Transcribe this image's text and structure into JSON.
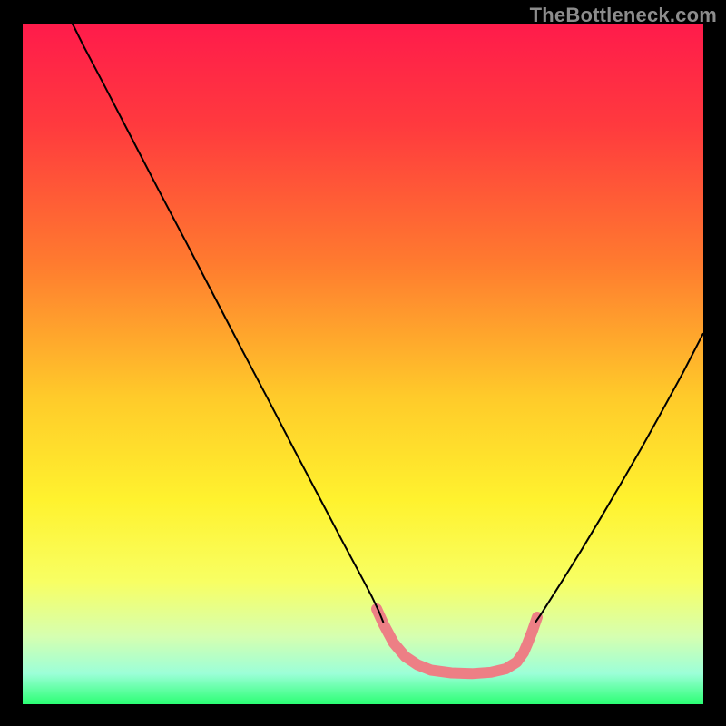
{
  "attribution": "TheBottleneck.com",
  "chart_data": {
    "type": "line",
    "title": "",
    "xlabel": "",
    "ylabel": "",
    "xlim": [
      0,
      1
    ],
    "ylim": [
      0,
      1
    ],
    "gradient_stops": [
      {
        "offset": 0.0,
        "color": "#ff1b4b"
      },
      {
        "offset": 0.15,
        "color": "#ff3a3e"
      },
      {
        "offset": 0.35,
        "color": "#ff7a2f"
      },
      {
        "offset": 0.55,
        "color": "#ffcb2a"
      },
      {
        "offset": 0.7,
        "color": "#fff22e"
      },
      {
        "offset": 0.82,
        "color": "#f8ff63"
      },
      {
        "offset": 0.9,
        "color": "#d6ffb0"
      },
      {
        "offset": 0.955,
        "color": "#9cffd8"
      },
      {
        "offset": 1.0,
        "color": "#2bff74"
      }
    ],
    "series": [
      {
        "name": "left-curve",
        "stroke": "#000000",
        "stroke_width": 2,
        "points": [
          [
            0.073,
            1.0
          ],
          [
            0.09,
            0.966
          ],
          [
            0.12,
            0.909
          ],
          [
            0.16,
            0.832
          ],
          [
            0.2,
            0.755
          ],
          [
            0.24,
            0.679
          ],
          [
            0.28,
            0.602
          ],
          [
            0.32,
            0.525
          ],
          [
            0.36,
            0.449
          ],
          [
            0.4,
            0.372
          ],
          [
            0.44,
            0.296
          ],
          [
            0.47,
            0.239
          ],
          [
            0.5,
            0.183
          ],
          [
            0.513,
            0.158
          ],
          [
            0.523,
            0.137
          ],
          [
            0.53,
            0.12
          ]
        ]
      },
      {
        "name": "right-curve",
        "stroke": "#000000",
        "stroke_width": 2,
        "points": [
          [
            0.753,
            0.12
          ],
          [
            0.762,
            0.133
          ],
          [
            0.776,
            0.155
          ],
          [
            0.795,
            0.185
          ],
          [
            0.82,
            0.225
          ],
          [
            0.85,
            0.275
          ],
          [
            0.88,
            0.326
          ],
          [
            0.91,
            0.378
          ],
          [
            0.94,
            0.432
          ],
          [
            0.97,
            0.487
          ],
          [
            1.0,
            0.545
          ]
        ]
      },
      {
        "name": "pink-band",
        "stroke": "#ed7f85",
        "stroke_width": 12,
        "linecap": "round",
        "points": [
          [
            0.52,
            0.14
          ],
          [
            0.53,
            0.118
          ],
          [
            0.545,
            0.09
          ],
          [
            0.562,
            0.07
          ],
          [
            0.58,
            0.058
          ],
          [
            0.6,
            0.05
          ],
          [
            0.63,
            0.046
          ],
          [
            0.66,
            0.045
          ],
          [
            0.688,
            0.047
          ],
          [
            0.71,
            0.052
          ],
          [
            0.726,
            0.062
          ],
          [
            0.736,
            0.076
          ],
          [
            0.742,
            0.09
          ],
          [
            0.749,
            0.108
          ],
          [
            0.756,
            0.128
          ]
        ]
      }
    ]
  }
}
